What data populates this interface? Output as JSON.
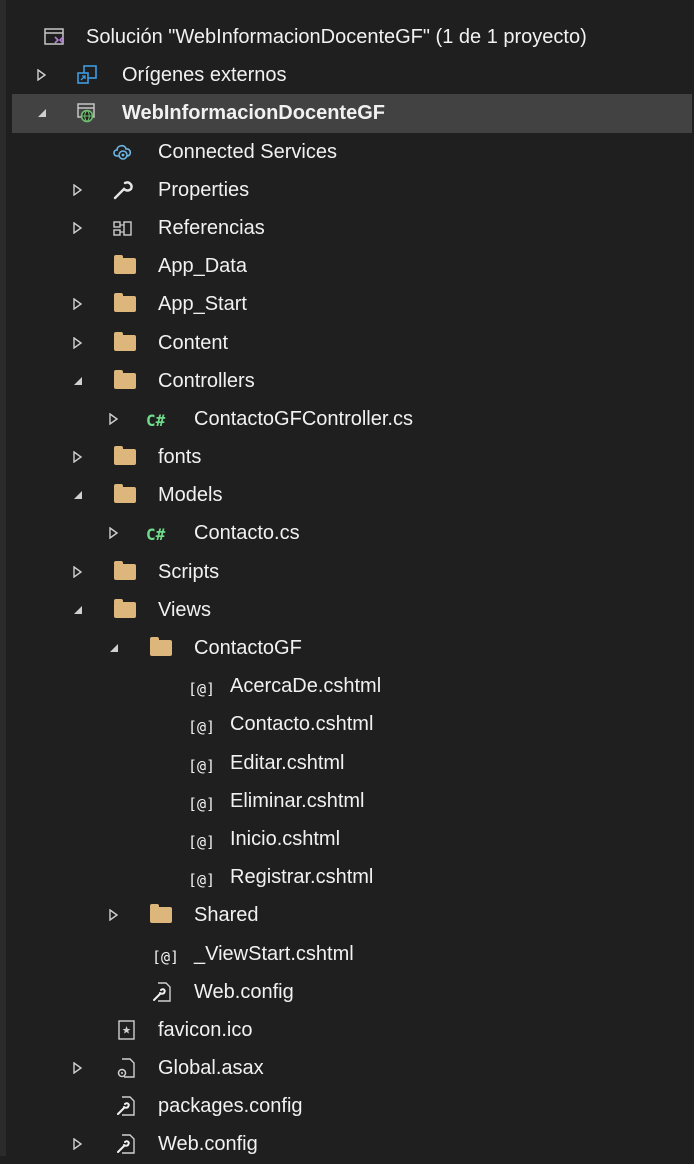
{
  "solution": {
    "label": "Solución \"WebInformacionDocenteGF\"  (1 de 1 proyecto)"
  },
  "nodes": [
    {
      "label": "Orígenes externos"
    },
    {
      "label": "WebInformacionDocenteGF"
    },
    {
      "label": "Connected Services"
    },
    {
      "label": "Properties"
    },
    {
      "label": "Referencias"
    },
    {
      "label": "App_Data"
    },
    {
      "label": "App_Start"
    },
    {
      "label": "Content"
    },
    {
      "label": "Controllers"
    },
    {
      "label": "ContactoGFController.cs"
    },
    {
      "label": "fonts"
    },
    {
      "label": "Models"
    },
    {
      "label": "Contacto.cs"
    },
    {
      "label": "Scripts"
    },
    {
      "label": "Views"
    },
    {
      "label": "ContactoGF"
    },
    {
      "label": "AcercaDe.cshtml"
    },
    {
      "label": "Contacto.cshtml"
    },
    {
      "label": "Editar.cshtml"
    },
    {
      "label": "Eliminar.cshtml"
    },
    {
      "label": "Inicio.cshtml"
    },
    {
      "label": "Registrar.cshtml"
    },
    {
      "label": "Shared"
    },
    {
      "label": "_ViewStart.cshtml"
    },
    {
      "label": "Web.config"
    },
    {
      "label": "favicon.ico"
    },
    {
      "label": "Global.asax"
    },
    {
      "label": "packages.config"
    },
    {
      "label": "Web.config"
    }
  ],
  "glyphs": {
    "cs": "C#",
    "razor": "[@]"
  },
  "colors": {
    "background": "#1f1f1f",
    "selected_row": "#424242",
    "folder": "#dcb67a",
    "csharp": "#6fdc8c",
    "text": "#f1f1f1"
  }
}
